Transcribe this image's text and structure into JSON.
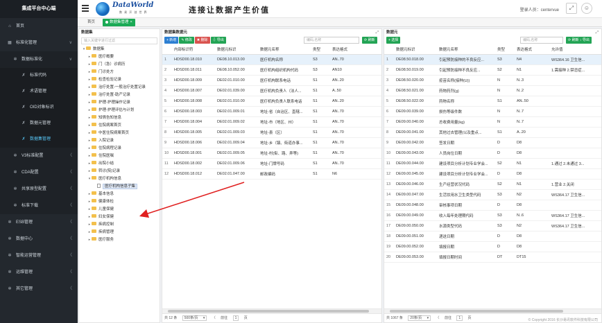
{
  "app_title": "集成平台中心端",
  "sidebar": {
    "items": [
      {
        "label": "首页",
        "icon": "home-icon",
        "glyph": "⌂",
        "level": 0,
        "chevron": ""
      },
      {
        "label": "标准化管理",
        "icon": "grid-icon",
        "glyph": "▦",
        "level": 0,
        "chevron": "∨"
      },
      {
        "label": "数据标准化",
        "icon": "gear-icon",
        "glyph": "✲",
        "level": 1,
        "chevron": "∨"
      },
      {
        "label": "标准代码",
        "icon": "tool-icon",
        "glyph": "✗",
        "level": 2,
        "chevron": ""
      },
      {
        "label": "术语管理",
        "icon": "tool-icon",
        "glyph": "✗",
        "level": 2,
        "chevron": ""
      },
      {
        "label": "OID对象标识",
        "icon": "tool-icon",
        "glyph": "✗",
        "level": 2,
        "chevron": ""
      },
      {
        "label": "数据元管理",
        "icon": "tool-icon",
        "glyph": "✗",
        "level": 2,
        "chevron": ""
      },
      {
        "label": "数据集管理",
        "icon": "tool-icon",
        "glyph": "✗",
        "level": 2,
        "chevron": "",
        "active": true
      },
      {
        "label": "V3标准配置",
        "icon": "gear-icon",
        "glyph": "✲",
        "level": 1,
        "chevron": "〈"
      },
      {
        "label": "CDA配置",
        "icon": "gear-icon",
        "glyph": "✲",
        "level": 1,
        "chevron": "〈"
      },
      {
        "label": "共享原型配置",
        "icon": "gear-icon",
        "glyph": "✲",
        "level": 1,
        "chevron": "〈"
      },
      {
        "label": "标准下载",
        "icon": "gear-icon",
        "glyph": "✲",
        "level": 1,
        "chevron": "〈"
      },
      {
        "label": "ESB管理",
        "icon": "gear-icon",
        "glyph": "✲",
        "level": 0,
        "chevron": "〈"
      },
      {
        "label": "数据中心",
        "icon": "gear-icon",
        "glyph": "✲",
        "level": 0,
        "chevron": "〈"
      },
      {
        "label": "智能运营管理",
        "icon": "gear-icon",
        "glyph": "✲",
        "level": 0,
        "chevron": "〈"
      },
      {
        "label": "运维管理",
        "icon": "gear-icon",
        "glyph": "✲",
        "level": 0,
        "chevron": "〈"
      },
      {
        "label": "其它管理",
        "icon": "gear-icon",
        "glyph": "✲",
        "level": 0,
        "chevron": "〈"
      }
    ]
  },
  "header": {
    "brand": "DataWorld",
    "brand_sub": "数 易 开 创 世 界",
    "slogan": "连接让数据产生价值",
    "login_label": "登录人员：centervue"
  },
  "tabs": {
    "home": "首页",
    "current": "数据集管理"
  },
  "tree_panel": {
    "title": "数据集",
    "search_placeholder": "输入关键字进行过滤",
    "nodes": [
      {
        "label": "数据集",
        "level": 0,
        "toggle": "▾",
        "kind": "folder"
      },
      {
        "label": "医疗概要",
        "level": 1,
        "toggle": "▸",
        "kind": "folder"
      },
      {
        "label": "门（急）诊病历",
        "level": 1,
        "toggle": "▸",
        "kind": "folder"
      },
      {
        "label": "门诊处方",
        "level": 1,
        "toggle": "▸",
        "kind": "folder"
      },
      {
        "label": "检查检验记录",
        "level": 1,
        "toggle": "▸",
        "kind": "folder"
      },
      {
        "label": "治疗处置-一般治疗处置记录",
        "level": 1,
        "toggle": "▸",
        "kind": "folder"
      },
      {
        "label": "治疗处置-助产记录",
        "level": 1,
        "toggle": "▸",
        "kind": "folder"
      },
      {
        "label": "护理-护理操作记录",
        "level": 1,
        "toggle": "▸",
        "kind": "folder"
      },
      {
        "label": "护理-护理评估与计划",
        "level": 1,
        "toggle": "▸",
        "kind": "folder"
      },
      {
        "label": "知情告知信息",
        "level": 1,
        "toggle": "▸",
        "kind": "folder"
      },
      {
        "label": "住院病案首页",
        "level": 1,
        "toggle": "▸",
        "kind": "folder"
      },
      {
        "label": "中医住院病案首页",
        "level": 1,
        "toggle": "▸",
        "kind": "folder"
      },
      {
        "label": "入院记录",
        "level": 1,
        "toggle": "▸",
        "kind": "folder"
      },
      {
        "label": "住院病程记录",
        "level": 1,
        "toggle": "▸",
        "kind": "folder"
      },
      {
        "label": "住院医嘱",
        "level": 1,
        "toggle": "▸",
        "kind": "folder"
      },
      {
        "label": "出院小结",
        "level": 1,
        "toggle": "▸",
        "kind": "folder"
      },
      {
        "label": "转诊(院)记录",
        "level": 1,
        "toggle": "▸",
        "kind": "folder"
      },
      {
        "label": "医疗机构信息",
        "level": 1,
        "toggle": "▾",
        "kind": "folder"
      },
      {
        "label": "医疗机构信息子集",
        "level": 2,
        "toggle": "",
        "kind": "doc",
        "selected": true
      },
      {
        "label": "基本信息",
        "level": 1,
        "toggle": "▸",
        "kind": "folder"
      },
      {
        "label": "健康体检",
        "level": 1,
        "toggle": "▸",
        "kind": "folder"
      },
      {
        "label": "儿童保健",
        "level": 1,
        "toggle": "▸",
        "kind": "folder"
      },
      {
        "label": "妇女保健",
        "level": 1,
        "toggle": "▸",
        "kind": "folder"
      },
      {
        "label": "疾病控制",
        "level": 1,
        "toggle": "▸",
        "kind": "folder"
      },
      {
        "label": "疾病管理",
        "level": 1,
        "toggle": "▸",
        "kind": "folder"
      },
      {
        "label": "医疗服务",
        "level": 1,
        "toggle": "▸",
        "kind": "folder"
      }
    ]
  },
  "dataset_panel": {
    "title": "数据集数据元",
    "buttons": {
      "add": "+ 新增",
      "edit": "修改",
      "delete": "删除",
      "export": "导出",
      "search": "刷新"
    },
    "search_placeholder": "编码,名称",
    "columns": [
      "",
      "内部标识符",
      "数据元标识",
      "数据元名称",
      "类型",
      "表达格式"
    ],
    "rows": [
      [
        "1",
        "HDSD00.18.010",
        "DE08.10.013.00",
        "医疗机构名称",
        "S3",
        "AN..70"
      ],
      [
        "2",
        "HDSD00.18.011",
        "DE08.10.052.00",
        "医疗机构组织机构代码",
        "S3",
        "AN10"
      ],
      [
        "3",
        "HDSD00.18.009",
        "DE02.01.010.00",
        "医疗机构联系电话",
        "S1",
        "AN..20"
      ],
      [
        "4",
        "HDSD00.18.007",
        "DE02.01.039.00",
        "医疗机构负责人（法人...",
        "S1",
        "A..50"
      ],
      [
        "5",
        "HDSD00.18.008",
        "DE02.01.010.00",
        "医疗机构负责人联系电话",
        "S1",
        "AN..20"
      ],
      [
        "6",
        "HDSD00.18.003",
        "DE02.01.009.01",
        "地址-省（自治区、直辖...",
        "S1",
        "AN..70"
      ],
      [
        "7",
        "HDSD00.18.004",
        "DE02.01.009.02",
        "地址-市（地区、州）",
        "S1",
        "AN..70"
      ],
      [
        "8",
        "HDSD00.18.005",
        "DE02.01.009.03",
        "地址-县（区）",
        "S1",
        "AN..70"
      ],
      [
        "9",
        "HDSD00.18.006",
        "DE02.01.009.04",
        "地址-乡（镇、街道办事...",
        "S1",
        "AN..70"
      ],
      [
        "10",
        "HDSD00.18.001",
        "DE02.01.009.05",
        "地址-村(街、路、弄等)",
        "S1",
        "AN..70"
      ],
      [
        "11",
        "HDSD00.18.002",
        "DE02.01.009.06",
        "地址-门牌号码",
        "S1",
        "AN..70"
      ],
      [
        "12",
        "HDSD00.18.012",
        "DE02.01.047.00",
        "邮政编码",
        "S1",
        "N6"
      ]
    ],
    "pager": {
      "total": "共 12 条",
      "page_size": "500条/页",
      "prev": "前往",
      "page": "1",
      "unit": "页"
    }
  },
  "elements_panel": {
    "title": "数据元",
    "buttons": {
      "add": "+ 选择",
      "refresh": "刷新",
      "export": "刷新 ↕ 导出"
    },
    "search_placeholder": "编码,名称",
    "columns": [
      "",
      "数据元标识",
      "数据元名称",
      "类型",
      "表达格式",
      "允许值"
    ],
    "rows": [
      [
        "1",
        "DE08.50.018.00",
        "引起预防接种的不良反应...",
        "S3",
        "N4",
        "WS364.16 卫生信..."
      ],
      [
        "2",
        "DE08.50.019.00",
        "引起预防接种不良反应...",
        "S2",
        "N1",
        "1.需接种 2.禁忌症..."
      ],
      [
        "3",
        "DE08.50.020.00",
        "疫苗名称(接种(U))",
        "N",
        "N..3",
        ""
      ],
      [
        "4",
        "DE08.50.021.00",
        "药物药剂(g)",
        "N",
        "N..2",
        ""
      ],
      [
        "5",
        "DE08.50.022.00",
        "药物名称",
        "S1",
        "AN..50",
        ""
      ],
      [
        "6",
        "DE09.00.039.00",
        "损伤等级件数",
        "N",
        "N..7",
        ""
      ],
      [
        "7",
        "DE09.00.040.00",
        "总收费用量(kg)",
        "N",
        "N..7",
        ""
      ],
      [
        "8",
        "DE09.00.041.00",
        "其他过去管理(以及重点...",
        "S1",
        "A..20",
        ""
      ],
      [
        "9",
        "DE09.00.042.00",
        "签发日期",
        "D",
        "D8",
        ""
      ],
      [
        "10",
        "DE09.00.043.00",
        "人员岗位日期",
        "D",
        "D8",
        ""
      ],
      [
        "11",
        "DE09.00.044.00",
        "建设项目分析计划专业学会...",
        "S2",
        "N1",
        "1.通过 2.未通过 3..."
      ],
      [
        "12",
        "DE09.00.045.00",
        "建设项目分析计划专业学会...",
        "D",
        "D8",
        ""
      ],
      [
        "13",
        "DE09.00.046.00",
        "生产经营状况代码",
        "S2",
        "N1",
        "1.营业 2.关闭"
      ],
      [
        "14",
        "DE09.00.047.00",
        "生活饮用水卫生类型代码",
        "S3",
        "N2",
        "WS364.17 卫生信..."
      ],
      [
        "15",
        "DE09.00.048.00",
        "审核事项日期",
        "D",
        "D8",
        ""
      ],
      [
        "16",
        "DE09.00.049.00",
        "收入每年处理期代码",
        "S3",
        "N..6",
        "WS364.17 卫生信..."
      ],
      [
        "17",
        "DE09.00.050.00",
        "水源类型代码",
        "S3",
        "N2",
        "WS364.17 卫生信..."
      ],
      [
        "18",
        "DE09.00.051.00",
        "递送日期",
        "D",
        "D8",
        ""
      ],
      [
        "19",
        "DE09.00.052.00",
        "填报日期",
        "D",
        "D8",
        ""
      ],
      [
        "20",
        "DE09.00.053.00",
        "填报日期时间",
        "DT",
        "DT15",
        ""
      ]
    ],
    "pager": {
      "total": "共 1067 条",
      "page_size": "20条/页",
      "prev": "前往",
      "page": "1",
      "unit": "页"
    }
  },
  "copyright": "© Copyright 2016 长沙易讯软件科技有限公司",
  "colors": {
    "sidebar_bg": "#23282e",
    "accent_green": "#1aaa55",
    "accent_blue": "#2d7fd2",
    "active_nav": "#57c5f5",
    "annotation_arrow": "#e02020"
  }
}
